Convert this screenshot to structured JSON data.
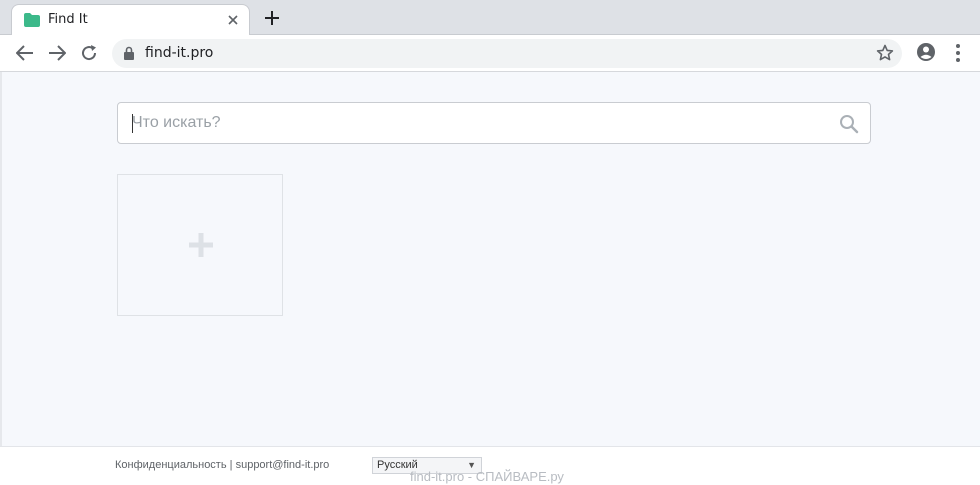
{
  "browser": {
    "tab_title": "Find It",
    "url": "find-it.pro",
    "favicon_color": "#3cb98a"
  },
  "search": {
    "placeholder": "Что искать?",
    "value": ""
  },
  "tiles": {
    "add_tile_label": "+"
  },
  "footer": {
    "privacy_label": "Конфиденциальность",
    "separator": "|",
    "support_email": "support@find-it.pro",
    "language_selected": "Русский",
    "watermark": "find-it.pro - СПАЙВАРЕ.ру"
  },
  "colors": {
    "page_background": "#f6f8fc",
    "tab_strip": "#dee1e6",
    "accent": "#3cb98a"
  }
}
